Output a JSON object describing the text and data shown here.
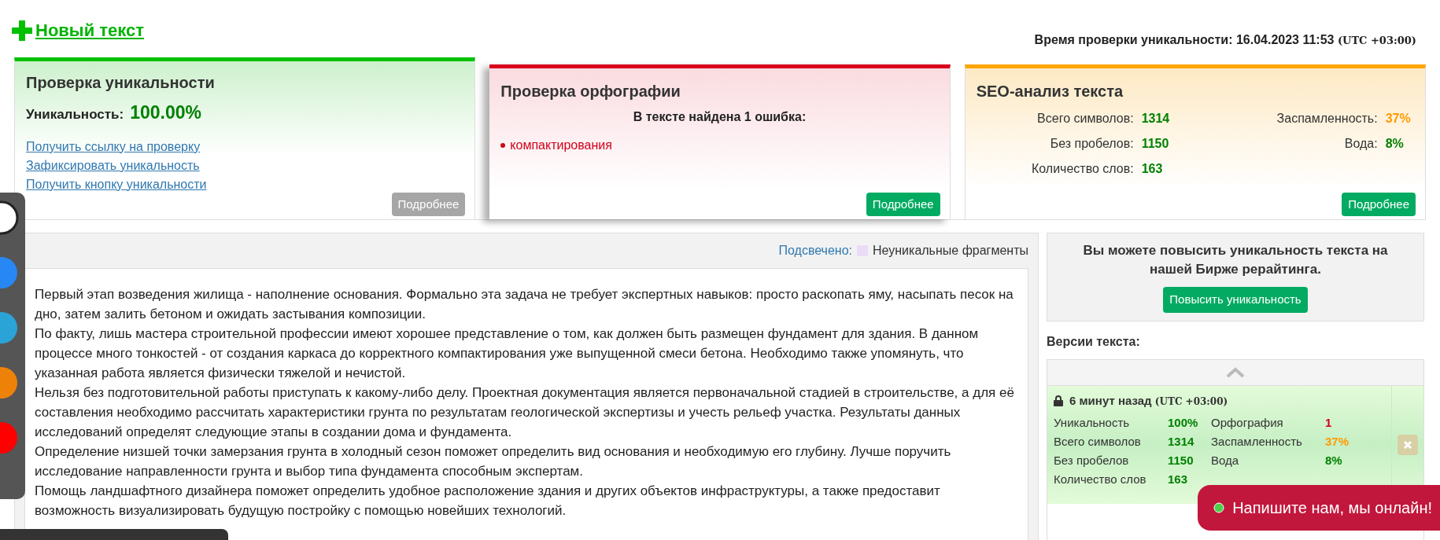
{
  "header": {
    "new_text_link": "Новый текст",
    "check_time_label": "Время проверки уникальности:",
    "check_time": "16.04.2023 11:53",
    "timezone": "(UTC +03:00)"
  },
  "uniqueness_card": {
    "title": "Проверка уникальности",
    "label": "Уникальность:",
    "value": "100.00%",
    "links": [
      "Получить ссылку на проверку",
      "Зафиксировать уникальность",
      "Получить кнопку уникальности"
    ],
    "button": "Подробнее",
    "disabled": true
  },
  "spelling_card": {
    "title": "Проверка орфографии",
    "summary": "В тексте найдена 1 ошибка:",
    "errors": [
      "компактирования"
    ],
    "button": "Подробнее",
    "disabled": false
  },
  "seo_card": {
    "title": "SEO-анализ текста",
    "stats_left": [
      {
        "label": "Всего символов:",
        "value": "1314",
        "color": "#008000"
      },
      {
        "label": "Без пробелов:",
        "value": "1150",
        "color": "#008000"
      },
      {
        "label": "Количество слов:",
        "value": "163",
        "color": "#008000"
      }
    ],
    "stats_right": [
      {
        "label": "Заспамленность:",
        "value": "37%",
        "color": "#ff9900"
      },
      {
        "label": "Вода:",
        "value": "8%",
        "color": "#008000"
      }
    ],
    "button": "Подробнее",
    "disabled": false
  },
  "highlight_legend": {
    "label": "Подсвечено:",
    "text": "Неуникальные фрагменты",
    "color": "#eadcf8"
  },
  "text_paragraphs": [
    "Первый этап возведения жилища - наполнение основания. Формально эта задача не требует экспертных навыков: просто раскопать яму, насыпать песок на дно, затем залить бетоном и ожидать застывания композиции.",
    "По факту, лишь мастера строительной профессии имеют хорошее представление о том, как должен быть размещен фундамент для здания. В данном процессе много тонкостей - от создания каркаса до корректного компактирования уже выпущенной смеси бетона. Необходимо также упомянуть, что указанная работа является физически тяжелой и нечистой.",
    "Нельзя без подготовительной работы приступать к какому-либо делу. Проектная документация является первоначальной стадией в строительстве, а для её составления необходимо рассчитать характеристики грунта по результатам геологической экспертизы и учесть рельеф участка. Результаты данных исследований определят следующие этапы в создании дома и фундамента.",
    "Определение низшей точки замерзания грунта в холодный сезон поможет определить вид основания и необходимую его глубину. Лучше поручить исследование направленности грунта и выбор типа фундамента способным экспертам.",
    "Помощь ландшафтного дизайнера поможет определить удобное расположение здания и других объектов инфраструктуры, а также предоставит возможность визуализировать будущую постройку с помощью новейших технологий."
  ],
  "promo": {
    "text": "Вы можете повысить уникальность текста на нашей Бирже рерайтинга.",
    "button": "Повысить уникальность"
  },
  "versions": {
    "title": "Версии текста:",
    "items": [
      {
        "time": "6 минут назад",
        "timezone": "(UTC +03:00)",
        "locked": true,
        "stats": [
          {
            "label": "Уникальность",
            "value": "100%",
            "color": "#008000"
          },
          {
            "label": "Орфография",
            "value": "1",
            "color": "#d0021b"
          },
          {
            "label": "Всего символов",
            "value": "1314",
            "color": "#008000"
          },
          {
            "label": "Заспамленность",
            "value": "37%",
            "color": "#ff9900"
          },
          {
            "label": "Без пробелов",
            "value": "1150",
            "color": "#008000"
          },
          {
            "label": "Вода",
            "value": "8%",
            "color": "#008000"
          },
          {
            "label": "Количество слов",
            "value": "163",
            "color": "#008000"
          }
        ]
      }
    ]
  },
  "chat": {
    "text": "Напишите нам, мы онлайн!"
  }
}
